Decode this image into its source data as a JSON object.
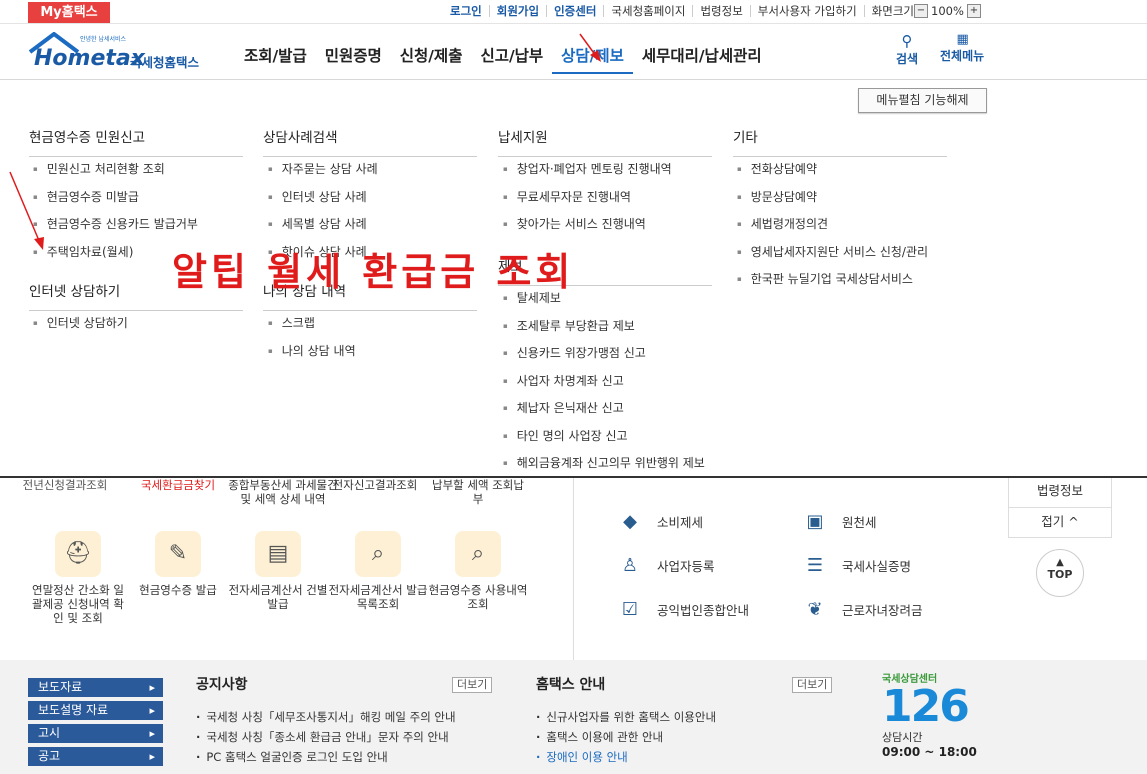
{
  "topbar": {
    "my_hometax": "My홈택스",
    "links": [
      "로그인",
      "회원가입",
      "인증센터",
      "국세청홈페이지",
      "법령정보",
      "부서사용자 가입하기",
      "화면크기"
    ],
    "zoom_minus": "−",
    "zoom_value": "100%",
    "zoom_plus": "+"
  },
  "header": {
    "logo_small": "안녕한 납세서비스",
    "logo_main": "Hometax",
    "logo_kr": "국세청홈택스",
    "nav": [
      "조회/발급",
      "민원증명",
      "신청/제출",
      "신고/납부",
      "상담/제보",
      "세무대리/납세관리"
    ],
    "search_label": "검색",
    "allmenu_label": "전체메뉴"
  },
  "mega": {
    "unfold_label": "메뉴펼침 기능해제",
    "col1": {
      "title": "현금영수증 민원신고",
      "items": [
        "민원신고 처리현황 조회",
        "현금영수증 미발급",
        "현금영수증 신용카드 발급거부",
        "주택임차료(월세)"
      ],
      "title2": "인터넷 상담하기",
      "items2": [
        "인터넷 상담하기"
      ]
    },
    "col2": {
      "title": "상담사례검색",
      "items": [
        "자주묻는 상담 사례",
        "인터넷 상담 사례",
        "세목별 상담 사례",
        "핫이슈 상담 사례"
      ],
      "title2": "나의 상담 내역",
      "items2": [
        "스크랩",
        "나의 상담 내역"
      ]
    },
    "col3": {
      "title": "납세지원",
      "items": [
        "창업자·폐업자 멘토링 진행내역",
        "무료세무자문 진행내역",
        "찾아가는 서비스 진행내역"
      ],
      "title2": "제보",
      "items2": [
        "탈세제보",
        "조세탈루 부당환급 제보",
        "신용카드 위장가맹점 신고",
        "사업자 차명계좌 신고",
        "체납자 은닉재산 신고",
        "타인 명의 사업장 신고",
        "해외금융계좌 신고의무 위반행위 제보"
      ]
    },
    "col4": {
      "title": "기타",
      "items": [
        "전화상담예약",
        "방문상담예약",
        "세법령개정의견",
        "영세납세자지원단 서비스 신청/관리",
        "한국판 뉴딜기업 국세상담서비스"
      ]
    },
    "overlay_text": "알팁 월세 환급금 조회"
  },
  "below": {
    "partial_row": [
      "전년신청결과조회",
      "국세환급금찾기",
      "종합부동산세 과세물건 및 세액 상세 내역",
      "전자신고결과조회",
      "납부할 세액 조회납부"
    ],
    "services": [
      {
        "label": "연말정산 간소화 일괄제공 신청내역 확인 및 조회",
        "icon": "⛑"
      },
      {
        "label": "현금영수증 발급",
        "icon": "✎"
      },
      {
        "label": "전자세금계산서 건별발급",
        "icon": "▤"
      },
      {
        "label": "전자세금계산서 발급목록조회",
        "icon": "⌕"
      },
      {
        "label": "현금영수증 사용내역조회",
        "icon": "⌕"
      }
    ],
    "right_items": [
      {
        "label": "소비제세",
        "icon": "◆"
      },
      {
        "label": "원천세",
        "icon": "▣"
      },
      {
        "label": "사업자등록",
        "icon": "♙"
      },
      {
        "label": "국세사실증명",
        "icon": "☰"
      },
      {
        "label": "공익법인종합안내",
        "icon": "☑"
      },
      {
        "label": "근로자녀장려금",
        "icon": "❦"
      }
    ],
    "side_law": "법령정보",
    "side_fold": "접기 ^",
    "top_label": "TOP"
  },
  "footer": {
    "buttons": [
      "보도자료",
      "보도설명 자료",
      "고시",
      "공고"
    ],
    "notice_title": "공지사항",
    "notice_more": "더보기",
    "notice_items": [
      "국세청 사칭「세무조사통지서」해킹 메일 주의 안내",
      "국세청 사칭「종소세 환급금 안내」문자 주의 안내",
      "PC 홈택스 얼굴인증 로그인 도입 안내"
    ],
    "guide_title": "홈택스 안내",
    "guide_more": "더보기",
    "guide_items": [
      "신규사업자를 위한 홈택스 이용안내",
      "홈택스 이용에 관한 안내",
      "장애인 이용 안내"
    ],
    "center_title": "국세상담센터",
    "center_num": "126",
    "center_hours_label": "상담시간",
    "center_hours": "09:00 ~ 18:00"
  },
  "colors": {
    "accent": "#1a6bc1",
    "brand_red": "#e8403f",
    "overlay_red": "#e01b1b",
    "footer_btn": "#2b5a9a"
  }
}
